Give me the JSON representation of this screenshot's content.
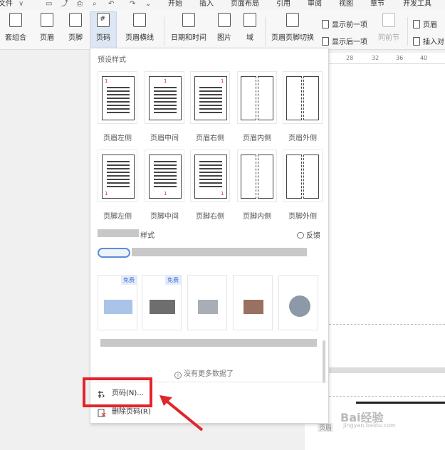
{
  "menubar": {
    "items": [
      "文件",
      "开始",
      "插入",
      "页面布局",
      "引用",
      "审阅",
      "视图",
      "章节",
      "开发工具"
    ]
  },
  "ribbon": {
    "buttons": [
      "套组合",
      "页眉",
      "页脚",
      "页码",
      "页眉横线",
      "日期和时间",
      "图片",
      "域",
      "页眉页脚切换",
      "同前节"
    ],
    "show_prev": "显示前一项",
    "show_next": "显示后一项",
    "header_right": "页眉",
    "insert_right": "插入对"
  },
  "ruler": {
    "ticks": [
      "28",
      "32",
      "36",
      "40"
    ]
  },
  "dropdown": {
    "preset_title": "预设样式",
    "header_styles": [
      "页眉左侧",
      "页眉中间",
      "页眉右侧",
      "页眉内侧",
      "页眉外侧"
    ],
    "footer_styles": [
      "页脚左侧",
      "页脚中间",
      "页脚右侧",
      "页脚内侧",
      "页脚外侧"
    ],
    "more_styles_suffix": "样式",
    "feedback": "反馈",
    "free_badge": "免费",
    "no_more_data": "没有更多数据了",
    "menu": {
      "page_number": "页码(N)...",
      "delete_page_number": "删除页码(R)"
    }
  },
  "doc": {
    "header_tag": "页眉"
  },
  "watermark": {
    "main": "Bai经验",
    "sub": "jingyan.baidu.com"
  },
  "colors": {
    "highlight": "#e2242b",
    "accent": "#3d6ed8"
  }
}
